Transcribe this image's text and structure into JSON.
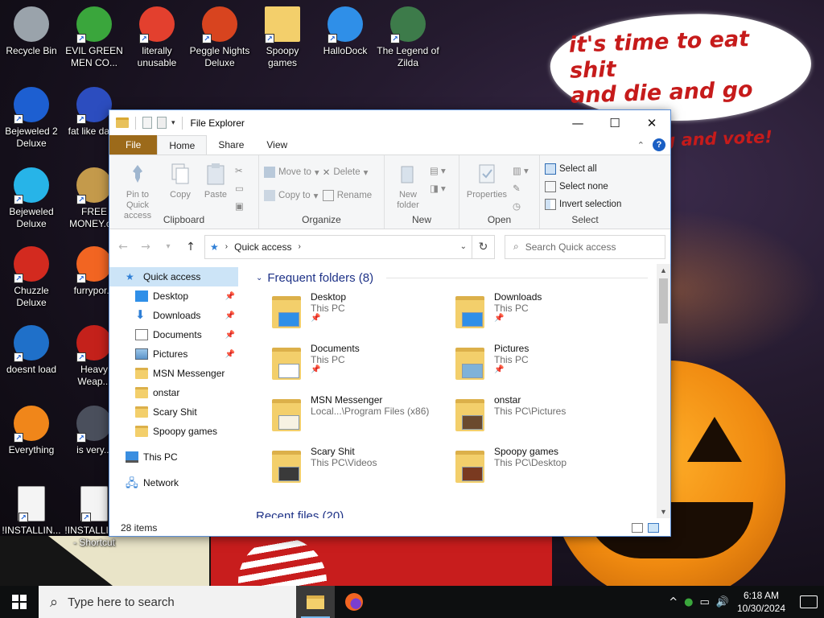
{
  "wallpaper": {
    "speech_line1": "it's time to eat shit",
    "speech_line2": "and die and go trick",
    "speech_line3": "or treating and vote!"
  },
  "desktop_icons": [
    {
      "label": "Recycle Bin",
      "icon": "recycle-bin-icon",
      "color": "#9aa3ab"
    },
    {
      "label": "EVIL GREEN MEN CO...",
      "icon": "msn-messenger-icon",
      "color": "#3aa63c"
    },
    {
      "label": "literally unusable",
      "icon": "chrome-icon",
      "color": "#e3402e"
    },
    {
      "label": "Peggle Nights Deluxe",
      "icon": "peggle-icon",
      "color": "#d8441f"
    },
    {
      "label": "Spoopy games",
      "icon": "folder-icon",
      "color": "#f3cf6b"
    },
    {
      "label": "HalloDock",
      "icon": "windows-logo-icon",
      "color": "#2f8fe8"
    },
    {
      "label": "The Legend of Zilda",
      "icon": "zilda-icon",
      "color": "#3d7b4a"
    },
    {
      "label": "Bejeweled 2 Deluxe",
      "icon": "bejeweled2-icon",
      "color": "#1d5fd1"
    },
    {
      "label": "fat like dar...",
      "icon": "mpl-icon",
      "color": "#2c4dbf"
    },
    {
      "label": "Bejeweled Deluxe",
      "icon": "diamond-icon",
      "color": "#27b4e8"
    },
    {
      "label": "FREE MONEY.c...",
      "icon": "money-bag-icon",
      "color": "#c49a4b"
    },
    {
      "label": "Chuzzle Deluxe",
      "icon": "chuzzle-icon",
      "color": "#d32a1f"
    },
    {
      "label": "furrypor...",
      "icon": "firefox-icon",
      "color": "#f26522"
    },
    {
      "label": "doesnt load",
      "icon": "thunderbird-icon",
      "color": "#1f70c9"
    },
    {
      "label": "Heavy Weap...",
      "icon": "radiation-icon",
      "color": "#c4211b"
    },
    {
      "label": "Everything",
      "icon": "everything-search-icon",
      "color": "#f0861a"
    },
    {
      "label": "is very...",
      "icon": "m-logo-icon",
      "color": "#4a4f5c"
    },
    {
      "label": "!INSTALLIN...",
      "icon": "text-file-icon",
      "color": "#f4f4f4"
    },
    {
      "label": "!INSTALLIN... - Shortcut",
      "icon": "text-file-shortcut-icon",
      "color": "#f4f4f4"
    }
  ],
  "window": {
    "title": "File Explorer",
    "controls": {
      "minimize": "—",
      "maximize": "☐",
      "close": "✕"
    },
    "tabs": [
      "File",
      "Home",
      "Share",
      "View"
    ],
    "active_tab": "Home",
    "ribbon": {
      "clipboard": {
        "label": "Clipboard",
        "pin": "Pin to Quick access",
        "copy": "Copy",
        "paste": "Paste"
      },
      "organize": {
        "label": "Organize",
        "move_to": "Move to",
        "copy_to": "Copy to",
        "delete": "Delete",
        "rename": "Rename"
      },
      "new": {
        "label": "New",
        "new_folder": "New folder"
      },
      "open": {
        "label": "Open",
        "properties": "Properties"
      },
      "select": {
        "label": "Select",
        "select_all": "Select all",
        "select_none": "Select none",
        "invert": "Invert selection"
      }
    },
    "address": {
      "path": "Quick access",
      "search_placeholder": "Search Quick access"
    },
    "nav": {
      "quick_access": "Quick access",
      "pinned": [
        "Desktop",
        "Downloads",
        "Documents",
        "Pictures"
      ],
      "folders": [
        "MSN Messenger",
        "onstar",
        "Scary Shit",
        "Spoopy games"
      ],
      "this_pc": "This PC",
      "network": "Network"
    },
    "frequent_header": "Frequent folders (8)",
    "recent_header": "Recent files (20)",
    "folders": [
      {
        "name": "Desktop",
        "location": "This PC",
        "pinned": true,
        "overlay": "#2f8fe8"
      },
      {
        "name": "Downloads",
        "location": "This PC",
        "pinned": true,
        "overlay": "#2f8fe8"
      },
      {
        "name": "Documents",
        "location": "This PC",
        "pinned": true,
        "overlay": "#ffffff"
      },
      {
        "name": "Pictures",
        "location": "This PC",
        "pinned": true,
        "overlay": "#7fb2d9"
      },
      {
        "name": "MSN Messenger",
        "location": "Local...\\Program Files (x86)",
        "pinned": false,
        "overlay": "#f7f2e2"
      },
      {
        "name": "onstar",
        "location": "This PC\\Pictures",
        "pinned": false,
        "overlay": "#6b4a2e"
      },
      {
        "name": "Scary Shit",
        "location": "This PC\\Videos",
        "pinned": false,
        "overlay": "#3a3a3a"
      },
      {
        "name": "Spoopy games",
        "location": "This PC\\Desktop",
        "pinned": false,
        "overlay": "#7a3a20"
      }
    ],
    "status": "28 items"
  },
  "taskbar": {
    "search_placeholder": "Type here to search",
    "time": "6:18 AM",
    "date": "10/30/2024",
    "tray_chevron": "^"
  },
  "colors": {
    "accent": "#1e3287",
    "file_tab": "#9c6a1a",
    "selection": "#cce4f7"
  }
}
